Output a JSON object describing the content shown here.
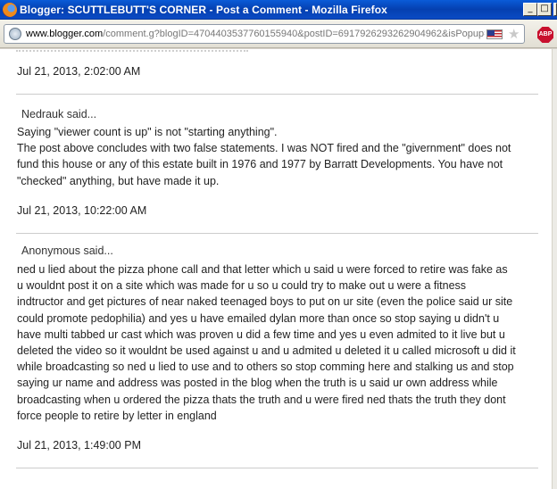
{
  "window": {
    "title": "Blogger: SCUTTLEBUTT'S CORNER - Post a Comment - Mozilla Firefox"
  },
  "address_bar": {
    "host": "www.blogger.com",
    "path": "/comment.g?blogID=4704403537760155940&postID=6917926293262904962&isPopup="
  },
  "comments": {
    "c0": {
      "date": "Jul 21, 2013, 2:02:00 AM"
    },
    "c1": {
      "author": "Nedrauk said...",
      "lines": [
        "Saying \"viewer count is up\" is not \"starting anything\".",
        "The post above concludes with two false statements. I was NOT fired and the \"givernment\" does not",
        "fund this house or any of this estate built in 1976 and 1977 by Barratt Developments. You have not",
        "\"checked\" anything, but have made it up."
      ],
      "date": "Jul 21, 2013, 10:22:00 AM"
    },
    "c2": {
      "author": "Anonymous said...",
      "lines": [
        "ned u lied about the pizza phone call and that letter which u said u were forced to retire was fake as",
        "u wouldnt post it on a site which was made for u so u could try to make out u were a fitness",
        "indtructor and get pictures of near naked teenaged boys to put on ur site (even the police said ur site",
        "could promote pedophilia) and yes u have emailed dylan more than once so stop saying u didn't u",
        "have multi tabbed ur cast which was proven u did a few time and yes u even admited to it live but u",
        "deleted the video so it wouldnt be used against u and u admited u deleted it u called microsoft u did it",
        "while broadcasting so ned u lied to use and to others so stop comming here and stalking us and stop",
        "saying ur name and address was posted in the blog when the truth is u said ur own address while",
        "broadcasting when u ordered the pizza thats the truth and u were fired ned thats the truth they dont",
        "force people to retire by letter in england"
      ],
      "date": "Jul 21, 2013, 1:49:00 PM"
    }
  },
  "icons": [
    "firefox-icon",
    "site-identity-icon",
    "us-flag-icon",
    "bookmark-star-icon",
    "adblock-plus-icon"
  ]
}
